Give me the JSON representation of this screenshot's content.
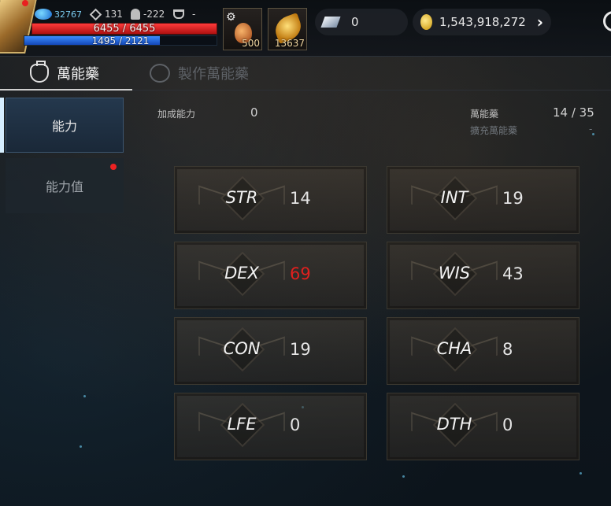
{
  "hud": {
    "exp": "32767",
    "attack": "131",
    "defense": "-222",
    "rank": "-",
    "hp": "6455 / 6455",
    "mp": "1495 / 2121",
    "mp_fraction": 0.705,
    "slot1_count": "500",
    "slot2_count": "13637",
    "gems": "0",
    "gold": "1,543,918,272"
  },
  "tabs": [
    {
      "label": "萬能藥",
      "active": true
    },
    {
      "label": "製作萬能藥",
      "active": false
    }
  ],
  "sidebar": {
    "items": [
      {
        "label": "能力"
      },
      {
        "label": "能力值"
      }
    ]
  },
  "info": {
    "bonus_label": "加成能力",
    "bonus_value": "0",
    "elixir_label": "萬能藥",
    "elixir_value": "14 / 35",
    "expand_label": "擴充萬能藥",
    "expand_value": "-"
  },
  "stats": [
    {
      "name": "STR",
      "value": "14"
    },
    {
      "name": "INT",
      "value": "19"
    },
    {
      "name": "DEX",
      "value": "69",
      "highlight_color": "#e0201e"
    },
    {
      "name": "WIS",
      "value": "43"
    },
    {
      "name": "CON",
      "value": "19"
    },
    {
      "name": "CHA",
      "value": "8"
    },
    {
      "name": "LFE",
      "value": "0"
    },
    {
      "name": "DTH",
      "value": "0"
    }
  ]
}
